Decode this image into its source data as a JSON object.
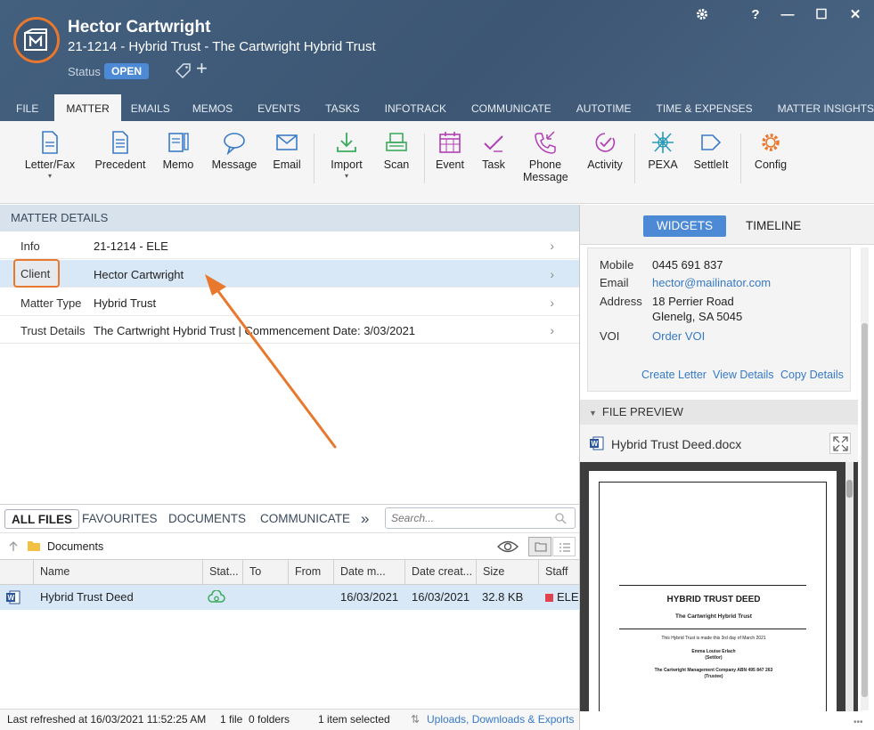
{
  "window": {
    "client_name": "Hector Cartwright",
    "matter_title": "21-1214 - Hybrid Trust - The Cartwright Hybrid Trust",
    "status_label": "Status",
    "status_value": "OPEN",
    "controls": {
      "help": "?",
      "minimize": "—",
      "maximize": "☐",
      "close": "✕"
    }
  },
  "tabs": [
    "FILE",
    "MATTER",
    "EMAILS",
    "MEMOS",
    "EVENTS",
    "TASKS",
    "INFOTRACK",
    "COMMUNICATE",
    "AUTOTIME",
    "TIME & EXPENSES",
    "MATTER INSIGHTS"
  ],
  "ribbon": {
    "letter_fax": "Letter/Fax",
    "precedent": "Precedent",
    "memo": "Memo",
    "message": "Message",
    "email": "Email",
    "import": "Import",
    "scan": "Scan",
    "event": "Event",
    "task": "Task",
    "phone_line1": "Phone",
    "phone_line2": "Message",
    "activity": "Activity",
    "pexa": "PEXA",
    "settleit": "SettleIt",
    "config": "Config",
    "caret": "▾"
  },
  "matter_details": {
    "header": "MATTER DETAILS",
    "rows": [
      {
        "label": "Info",
        "value": "21-1214 - ELE"
      },
      {
        "label": "Client",
        "value": "Hector Cartwright"
      },
      {
        "label": "Matter Type",
        "value": "Hybrid Trust"
      },
      {
        "label": "Trust Details",
        "value": "The Cartwright Hybrid Trust | Commencement Date: 3/03/2021"
      }
    ],
    "chevron": "›"
  },
  "files": {
    "tabs": [
      "ALL FILES",
      "FAVOURITES",
      "DOCUMENTS",
      "COMMUNICATE"
    ],
    "more": "»",
    "search_placeholder": "Search...",
    "folder": "Documents",
    "columns": [
      "Name",
      "Stat...",
      "To",
      "From",
      "Date m...",
      "Date creat...",
      "Size",
      "Staff"
    ],
    "row": {
      "name": "Hybrid Trust Deed",
      "to": "",
      "from": "",
      "date_modified": "16/03/2021",
      "date_created": "16/03/2021",
      "size": "32.8 KB",
      "staff": "ELE"
    },
    "status": {
      "refreshed": "Last refreshed at 16/03/2021 11:52:25 AM",
      "counts": "1 file  0 folders",
      "selected": "1 item selected",
      "uploads": "Uploads, Downloads & Exports"
    }
  },
  "right_panel": {
    "tabs": [
      "WIDGETS",
      "TIMELINE"
    ],
    "widget": {
      "mobile_label": "Mobile",
      "mobile": "0445 691 837",
      "email_label": "Email",
      "email": "hector@mailinator.com",
      "address_label": "Address",
      "address_line1": "18 Perrier Road",
      "address_line2": "Glenelg, SA 5045",
      "voi_label": "VOI",
      "voi": "Order VOI",
      "actions": [
        "Create Letter",
        "View Details",
        "Copy Details"
      ]
    },
    "file_preview": {
      "header": "FILE PREVIEW",
      "file_name": "Hybrid Trust Deed.docx",
      "doc_title": "HYBRID TRUST DEED",
      "doc_subtitle": "The Cartwright Hybrid Trust",
      "doc_line1": "This Hybrid Trust is made this 3rd day of March 2021",
      "doc_line2": "Emma Louise Erlach",
      "doc_line3": "(Settlor)",
      "doc_line4": "The Cartwright Management Company ABN 495 847 263",
      "doc_line5": "(Trustee)"
    }
  },
  "colors": {
    "titlebar": "#3f5875",
    "accent": "#e8782e",
    "badge": "#4d8ad6",
    "selection": "#d8e8f7"
  }
}
